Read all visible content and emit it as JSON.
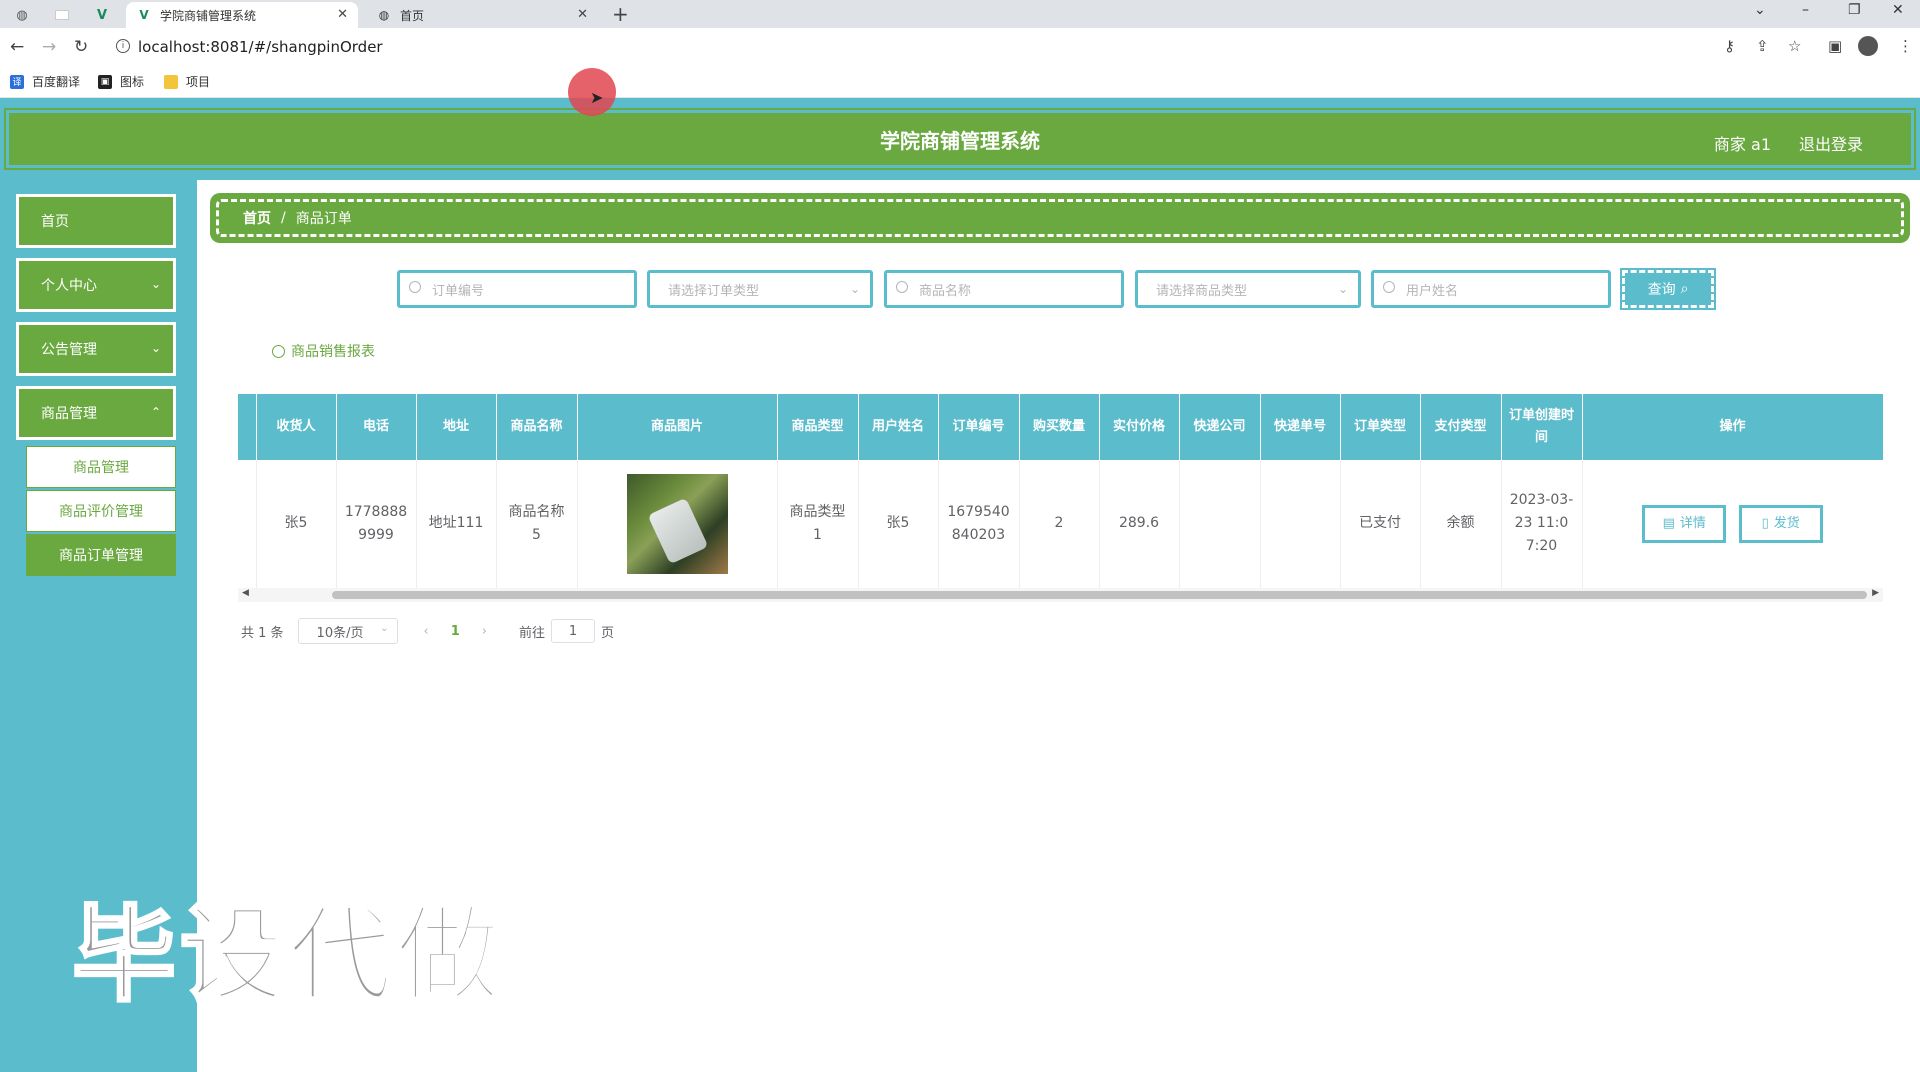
{
  "browser": {
    "tabs": [
      {
        "title": "学院商铺管理系统",
        "active": true
      },
      {
        "title": "首页",
        "active": false
      }
    ],
    "url": "localhost:8081/#/shangpinOrder",
    "bookmarks": [
      {
        "label": "百度翻译",
        "icon": "translate-icon"
      },
      {
        "label": "图标",
        "icon": "image-icon"
      },
      {
        "label": "项目",
        "icon": "folder-icon"
      }
    ]
  },
  "header": {
    "title": "学院商铺管理系统",
    "user": "商家 a1",
    "logout": "退出登录"
  },
  "sidebar": {
    "items": [
      {
        "label": "首页"
      },
      {
        "label": "个人中心"
      },
      {
        "label": "公告管理"
      },
      {
        "label": "商品管理"
      }
    ],
    "subitems": [
      {
        "label": "商品管理"
      },
      {
        "label": "商品评价管理"
      },
      {
        "label": "商品订单管理"
      }
    ]
  },
  "breadcrumb": {
    "home": "首页",
    "sep": "/",
    "current": "商品订单"
  },
  "search": {
    "order_no": "订单编号",
    "order_type": "请选择订单类型",
    "product_name": "商品名称",
    "product_type": "请选择商品类型",
    "user_name": "用户姓名",
    "query_label": "查询"
  },
  "report_link": "商品销售报表",
  "table": {
    "headers": [
      "收货人",
      "电话",
      "地址",
      "商品名称",
      "商品图片",
      "商品类型",
      "用户姓名",
      "订单编号",
      "购买数量",
      "实付价格",
      "快递公司",
      "快递单号",
      "订单类型",
      "支付类型",
      "订单创建时间",
      "操作"
    ],
    "rows": [
      {
        "receiver": "张5",
        "phone": "17788889999",
        "address": "地址111",
        "product_name": "商品名称5",
        "product_type": "商品类型1",
        "user_name": "张5",
        "order_no": "1679540840203",
        "quantity": "2",
        "price": "289.6",
        "express_company": "",
        "express_no": "",
        "order_type": "已支付",
        "pay_type": "余额",
        "created_at": "2023-03-23 11:07:20",
        "detail_label": "详情",
        "ship_label": "发货"
      }
    ]
  },
  "pagination": {
    "total": "共 1 条",
    "page_size": "10条/页",
    "current_page": "1",
    "goto_label": "前往",
    "goto_value": "1",
    "page_suffix": "页"
  },
  "watermark": "毕设代做",
  "colors": {
    "primary_green": "#6aa840",
    "primary_teal": "#5bbccc"
  }
}
